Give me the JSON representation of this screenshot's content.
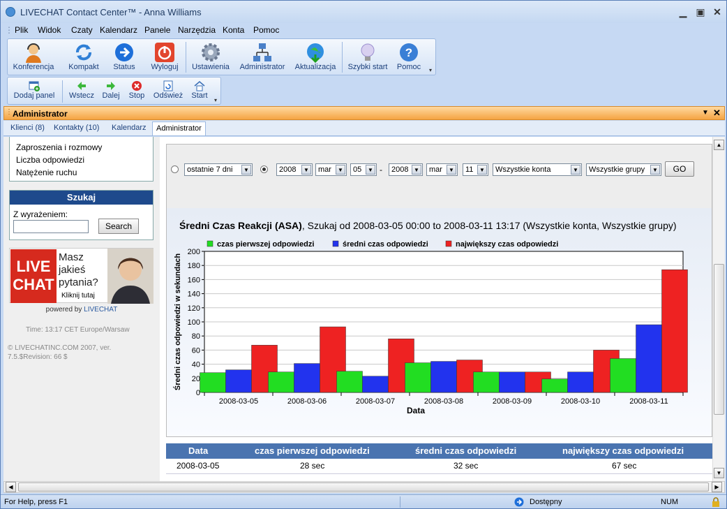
{
  "window": {
    "title": "LIVECHAT Contact Center™ - Anna Williams"
  },
  "menu": [
    "Plik",
    "Widok",
    "Czaty",
    "Kalendarz",
    "Panele",
    "Narzędzia",
    "Konta",
    "Pomoc"
  ],
  "toolbar_main": [
    {
      "label": "Konferencja",
      "icon": "agent-headset-icon"
    },
    {
      "label": "Kompakt",
      "icon": "refresh-arrows-icon"
    },
    {
      "label": "Status",
      "icon": "blue-arrow-icon"
    },
    {
      "label": "Wyloguj",
      "icon": "power-icon"
    },
    {
      "label": "Ustawienia",
      "icon": "gear-icon"
    },
    {
      "label": "Administrator",
      "icon": "network-icon"
    },
    {
      "label": "Aktualizacja",
      "icon": "globe-update-icon"
    },
    {
      "label": "Szybki start",
      "icon": "lightbulb-icon"
    },
    {
      "label": "Pomoc",
      "icon": "help-icon"
    }
  ],
  "toolbar_nav": [
    {
      "label": "Dodaj panel",
      "icon": "add-panel-icon"
    },
    {
      "label": "Wstecz",
      "icon": "back-arrow-icon"
    },
    {
      "label": "Dalej",
      "icon": "forward-arrow-icon"
    },
    {
      "label": "Stop",
      "icon": "stop-icon"
    },
    {
      "label": "Odśwież",
      "icon": "refresh-icon"
    },
    {
      "label": "Start",
      "icon": "home-icon"
    }
  ],
  "panel": {
    "title": "Administrator"
  },
  "tabs": [
    "Klienci (8)",
    "Kontakty (10)",
    "Kalendarz",
    "Administrator"
  ],
  "sidebar": {
    "links": [
      "Zaproszenia i rozmowy",
      "Liczba odpowiedzi",
      "Natężenie ruchu"
    ],
    "search_title": "Szukaj",
    "search_label": "Z wyrażeniem:",
    "search_value": "",
    "search_button": "Search",
    "ad_logo_line1": "LIVE",
    "ad_logo_line2": "CHAT",
    "ad_text_1": "Masz",
    "ad_text_2": "jakieś",
    "ad_text_3": "pytania?",
    "ad_link": "Kliknij tutaj",
    "powered_prefix": "powered by",
    "powered_brand": "LIVECHAT",
    "time": "Time: 13:17 CET Europe/Warsaw",
    "copyright_1": "© LIVECHATINC.COM 2007, ver.",
    "copyright_2": "7.5.$Revision: 66 $"
  },
  "filters": {
    "period": "ostatnie 7 dni",
    "from_year": "2008",
    "from_month": "mar",
    "from_day": "05",
    "dash": "-",
    "to_year": "2008",
    "to_month": "mar",
    "to_day": "11",
    "accounts": "Wszystkie konta",
    "groups": "Wszystkie grupy",
    "go": "GO"
  },
  "chart_heading_bold": "Średni Czas Reakcji (ASA)",
  "chart_heading_rest": ", Szukaj od 2008-03-05 00:00 to 2008-03-11 13:17 (Wszystkie konta, Wszystkie grupy)",
  "chart_data": {
    "type": "bar",
    "categories": [
      "2008-03-05",
      "2008-03-06",
      "2008-03-07",
      "2008-03-08",
      "2008-03-09",
      "2008-03-10",
      "2008-03-11"
    ],
    "series": [
      {
        "name": "czas pierwszej odpowiedzi",
        "color": "#22dd22",
        "values": [
          28,
          29,
          30,
          42,
          29,
          19,
          48
        ]
      },
      {
        "name": "średni czas odpowiedzi",
        "color": "#2233ee",
        "values": [
          32,
          41,
          23,
          44,
          29,
          29,
          96
        ]
      },
      {
        "name": "największy czas odpowiedzi",
        "color": "#ee2222",
        "values": [
          67,
          93,
          76,
          46,
          29,
          60,
          174
        ]
      }
    ],
    "xlabel": "Data",
    "ylabel": "Średni czas odpowiedzi w sekundach",
    "ylim": [
      0,
      200
    ],
    "yticks": [
      0,
      20,
      40,
      60,
      80,
      100,
      120,
      140,
      160,
      180,
      200
    ],
    "grid": true,
    "legend": "top"
  },
  "table": {
    "headers": [
      "Data",
      "czas pierwszej odpowiedzi",
      "średni czas odpowiedzi",
      "największy czas odpowiedzi"
    ],
    "rows": [
      [
        "2008-03-05",
        "28 sec",
        "32 sec",
        "67 sec"
      ]
    ]
  },
  "status": {
    "help": "For Help, press F1",
    "presence": "Dostępny",
    "num": "NUM"
  }
}
